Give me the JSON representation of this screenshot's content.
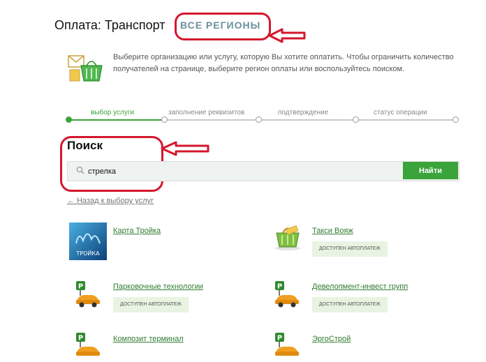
{
  "header": {
    "title": "Оплата: Транспорт",
    "regions_link": "ВСЕ РЕГИОНЫ"
  },
  "intro": {
    "text": "Выберите организацию или услугу, которую Вы хотите оплатить. Чтобы ограничить количество получателей на странице, выберите регион оплаты или воспользуйтесь поиском."
  },
  "steps": [
    {
      "label": "выбор услуги",
      "active": true
    },
    {
      "label": "заполнение реквизитов",
      "active": false
    },
    {
      "label": "подтверждение",
      "active": false
    },
    {
      "label": "статус операции",
      "active": false
    }
  ],
  "search": {
    "title": "Поиск",
    "value": "стрелка",
    "button_label": "Найти"
  },
  "back_link": "Назад к выбору услуг",
  "results": [
    {
      "name": "Карта Тройка",
      "badge": "",
      "icon": "troika-card-icon",
      "thumb_text": "ТРОЙКА"
    },
    {
      "name": "Такси Вояж",
      "badge": "доступен автоплатеж",
      "icon": "basket-icon"
    },
    {
      "name": "Парковочные технологии",
      "badge": "доступен автоплатеж",
      "icon": "parking-car-icon"
    },
    {
      "name": "Девелопмент-инвест групп",
      "badge": "доступен автоплатеж",
      "icon": "parking-car-icon"
    },
    {
      "name": "Композит терминал",
      "badge": "",
      "icon": "parking-car-icon"
    },
    {
      "name": "ЭргоСтрой",
      "badge": "",
      "icon": "parking-car-icon"
    }
  ],
  "colors": {
    "accent_green": "#3aa33a",
    "annotation_red": "#d4172d",
    "link_grey_blue": "#6b8e9e"
  }
}
